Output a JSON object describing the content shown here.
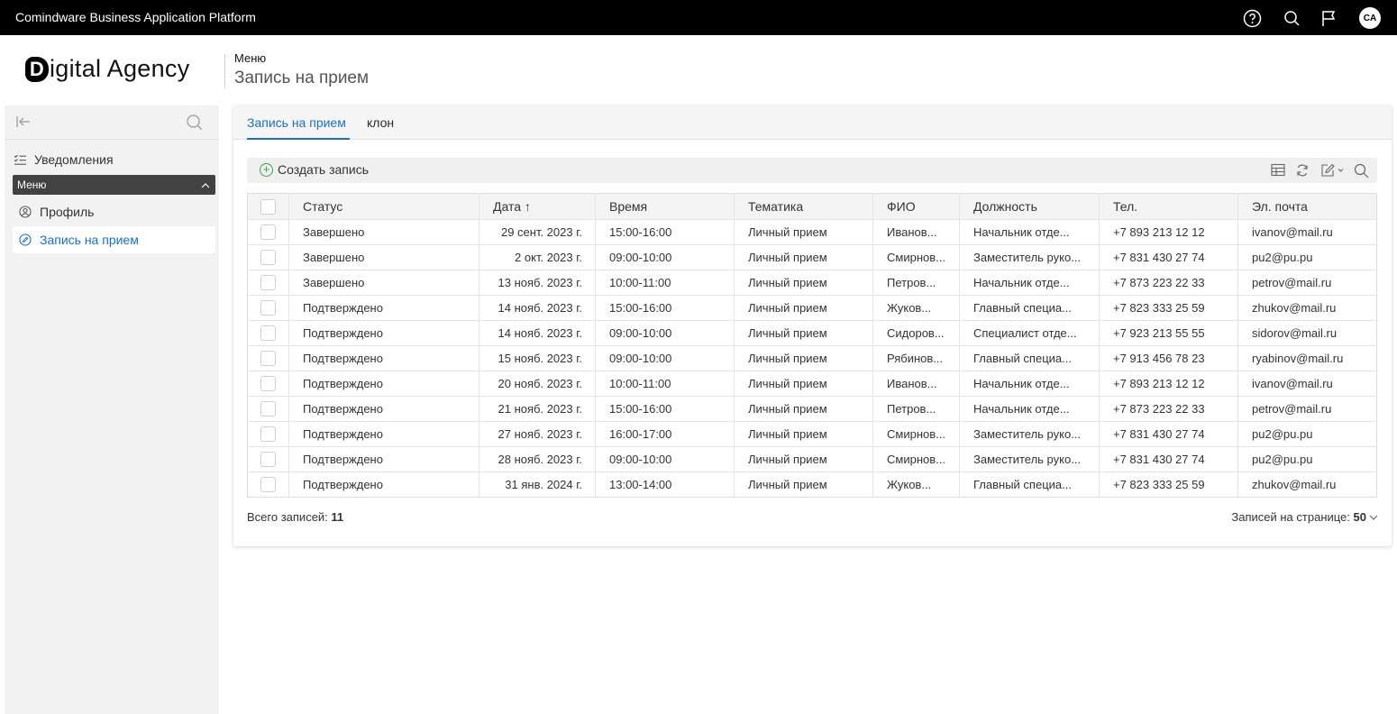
{
  "topbar": {
    "app_title": "Comindware Business Application Platform",
    "avatar_initials": "CA",
    "icons": [
      "help-icon",
      "search-icon",
      "flag-icon"
    ]
  },
  "header": {
    "logo_letter": "D",
    "logo_text": "igital Agency",
    "breadcrumb": "Меню",
    "title": "Запись на прием"
  },
  "sidebar": {
    "notifications_label": "Уведомления",
    "group_label": "Меню",
    "items": [
      {
        "label": "Профиль",
        "icon": "profile-icon"
      },
      {
        "label": "Запись на прием",
        "icon": "edit-icon"
      }
    ]
  },
  "tabs": [
    {
      "label": "Запись на прием"
    },
    {
      "label": "клон"
    }
  ],
  "toolbar": {
    "create_label": "Создать запись",
    "icons": [
      "table-icon",
      "refresh-icon",
      "edit-icon",
      "search-icon"
    ]
  },
  "table": {
    "columns": [
      "Статус",
      "Дата ↑",
      "Время",
      "Тематика",
      "ФИО",
      "Должность",
      "Тел.",
      "Эл. почта"
    ],
    "rows": [
      [
        "Завершено",
        "29 сент. 2023 г.",
        "15:00-16:00",
        "Личный прием",
        "Иванов...",
        "Начальник отде...",
        "+7 893 213 12 12",
        "ivanov@mail.ru"
      ],
      [
        "Завершено",
        "2 окт. 2023 г.",
        "09:00-10:00",
        "Личный прием",
        "Смирнов...",
        "Заместитель руко...",
        "+7 831 430 27 74",
        "pu2@pu.pu"
      ],
      [
        "Завершено",
        "13 нояб. 2023 г.",
        "10:00-11:00",
        "Личный прием",
        "Петров...",
        "Начальник отде...",
        "+7 873 223 22 33",
        "petrov@mail.ru"
      ],
      [
        "Подтверждено",
        "14 нояб. 2023 г.",
        "15:00-16:00",
        "Личный прием",
        "Жуков...",
        "Главный специа...",
        "+7 823 333 25 59",
        "zhukov@mail.ru"
      ],
      [
        "Подтверждено",
        "14 нояб. 2023 г.",
        "09:00-10:00",
        "Личный прием",
        "Сидоров...",
        "Специалист отде...",
        "+7 923 213 55 55",
        "sidorov@mail.ru"
      ],
      [
        "Подтверждено",
        "15 нояб. 2023 г.",
        "09:00-10:00",
        "Личный прием",
        "Рябинов...",
        "Главный специа...",
        "+7 913 456 78 23",
        "ryabinov@mail.ru"
      ],
      [
        "Подтверждено",
        "20 нояб. 2023 г.",
        "10:00-11:00",
        "Личный прием",
        "Иванов...",
        "Начальник отде...",
        "+7 893 213 12 12",
        "ivanov@mail.ru"
      ],
      [
        "Подтверждено",
        "21 нояб. 2023 г.",
        "15:00-16:00",
        "Личный прием",
        "Петров...",
        "Начальник отде...",
        "+7 873 223 22 33",
        "petrov@mail.ru"
      ],
      [
        "Подтверждено",
        "27 нояб. 2023 г.",
        "16:00-17:00",
        "Личный прием",
        "Смирнов...",
        "Заместитель руко...",
        "+7 831 430 27 74",
        "pu2@pu.pu"
      ],
      [
        "Подтверждено",
        "28 нояб. 2023 г.",
        "09:00-10:00",
        "Личный прием",
        "Смирнов...",
        "Заместитель руко...",
        "+7 831 430 27 74",
        "pu2@pu.pu"
      ],
      [
        "Подтверждено",
        "31 янв. 2024 г.",
        "13:00-14:00",
        "Личный прием",
        "Жуков...",
        "Главный специа...",
        "+7 823 333 25 59",
        "zhukov@mail.ru"
      ]
    ]
  },
  "footer": {
    "total_label": "Всего записей:",
    "total_value": "11",
    "per_page_label": "Записей на странице:",
    "per_page_value": "50"
  },
  "colors": {
    "accent": "#1f6fb5",
    "topbar": "#000000",
    "create_plus": "#3aa34a"
  }
}
